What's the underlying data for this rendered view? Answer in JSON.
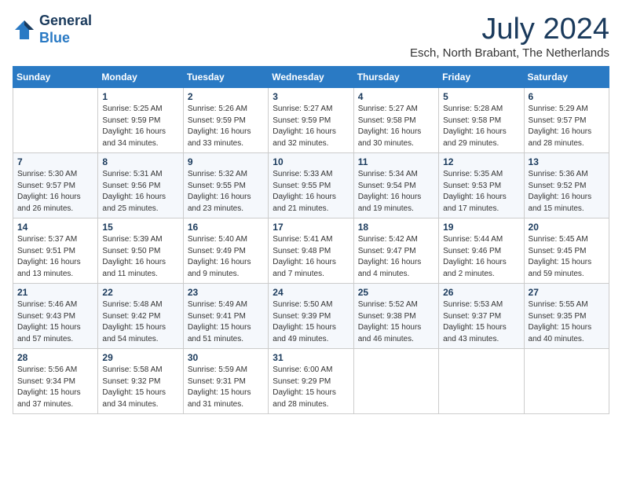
{
  "header": {
    "logo_line1": "General",
    "logo_line2": "Blue",
    "month_title": "July 2024",
    "location": "Esch, North Brabant, The Netherlands"
  },
  "columns": [
    "Sunday",
    "Monday",
    "Tuesday",
    "Wednesday",
    "Thursday",
    "Friday",
    "Saturday"
  ],
  "weeks": [
    [
      {
        "day": "",
        "info": ""
      },
      {
        "day": "1",
        "info": "Sunrise: 5:25 AM\nSunset: 9:59 PM\nDaylight: 16 hours\nand 34 minutes."
      },
      {
        "day": "2",
        "info": "Sunrise: 5:26 AM\nSunset: 9:59 PM\nDaylight: 16 hours\nand 33 minutes."
      },
      {
        "day": "3",
        "info": "Sunrise: 5:27 AM\nSunset: 9:59 PM\nDaylight: 16 hours\nand 32 minutes."
      },
      {
        "day": "4",
        "info": "Sunrise: 5:27 AM\nSunset: 9:58 PM\nDaylight: 16 hours\nand 30 minutes."
      },
      {
        "day": "5",
        "info": "Sunrise: 5:28 AM\nSunset: 9:58 PM\nDaylight: 16 hours\nand 29 minutes."
      },
      {
        "day": "6",
        "info": "Sunrise: 5:29 AM\nSunset: 9:57 PM\nDaylight: 16 hours\nand 28 minutes."
      }
    ],
    [
      {
        "day": "7",
        "info": "Sunrise: 5:30 AM\nSunset: 9:57 PM\nDaylight: 16 hours\nand 26 minutes."
      },
      {
        "day": "8",
        "info": "Sunrise: 5:31 AM\nSunset: 9:56 PM\nDaylight: 16 hours\nand 25 minutes."
      },
      {
        "day": "9",
        "info": "Sunrise: 5:32 AM\nSunset: 9:55 PM\nDaylight: 16 hours\nand 23 minutes."
      },
      {
        "day": "10",
        "info": "Sunrise: 5:33 AM\nSunset: 9:55 PM\nDaylight: 16 hours\nand 21 minutes."
      },
      {
        "day": "11",
        "info": "Sunrise: 5:34 AM\nSunset: 9:54 PM\nDaylight: 16 hours\nand 19 minutes."
      },
      {
        "day": "12",
        "info": "Sunrise: 5:35 AM\nSunset: 9:53 PM\nDaylight: 16 hours\nand 17 minutes."
      },
      {
        "day": "13",
        "info": "Sunrise: 5:36 AM\nSunset: 9:52 PM\nDaylight: 16 hours\nand 15 minutes."
      }
    ],
    [
      {
        "day": "14",
        "info": "Sunrise: 5:37 AM\nSunset: 9:51 PM\nDaylight: 16 hours\nand 13 minutes."
      },
      {
        "day": "15",
        "info": "Sunrise: 5:39 AM\nSunset: 9:50 PM\nDaylight: 16 hours\nand 11 minutes."
      },
      {
        "day": "16",
        "info": "Sunrise: 5:40 AM\nSunset: 9:49 PM\nDaylight: 16 hours\nand 9 minutes."
      },
      {
        "day": "17",
        "info": "Sunrise: 5:41 AM\nSunset: 9:48 PM\nDaylight: 16 hours\nand 7 minutes."
      },
      {
        "day": "18",
        "info": "Sunrise: 5:42 AM\nSunset: 9:47 PM\nDaylight: 16 hours\nand 4 minutes."
      },
      {
        "day": "19",
        "info": "Sunrise: 5:44 AM\nSunset: 9:46 PM\nDaylight: 16 hours\nand 2 minutes."
      },
      {
        "day": "20",
        "info": "Sunrise: 5:45 AM\nSunset: 9:45 PM\nDaylight: 15 hours\nand 59 minutes."
      }
    ],
    [
      {
        "day": "21",
        "info": "Sunrise: 5:46 AM\nSunset: 9:43 PM\nDaylight: 15 hours\nand 57 minutes."
      },
      {
        "day": "22",
        "info": "Sunrise: 5:48 AM\nSunset: 9:42 PM\nDaylight: 15 hours\nand 54 minutes."
      },
      {
        "day": "23",
        "info": "Sunrise: 5:49 AM\nSunset: 9:41 PM\nDaylight: 15 hours\nand 51 minutes."
      },
      {
        "day": "24",
        "info": "Sunrise: 5:50 AM\nSunset: 9:39 PM\nDaylight: 15 hours\nand 49 minutes."
      },
      {
        "day": "25",
        "info": "Sunrise: 5:52 AM\nSunset: 9:38 PM\nDaylight: 15 hours\nand 46 minutes."
      },
      {
        "day": "26",
        "info": "Sunrise: 5:53 AM\nSunset: 9:37 PM\nDaylight: 15 hours\nand 43 minutes."
      },
      {
        "day": "27",
        "info": "Sunrise: 5:55 AM\nSunset: 9:35 PM\nDaylight: 15 hours\nand 40 minutes."
      }
    ],
    [
      {
        "day": "28",
        "info": "Sunrise: 5:56 AM\nSunset: 9:34 PM\nDaylight: 15 hours\nand 37 minutes."
      },
      {
        "day": "29",
        "info": "Sunrise: 5:58 AM\nSunset: 9:32 PM\nDaylight: 15 hours\nand 34 minutes."
      },
      {
        "day": "30",
        "info": "Sunrise: 5:59 AM\nSunset: 9:31 PM\nDaylight: 15 hours\nand 31 minutes."
      },
      {
        "day": "31",
        "info": "Sunrise: 6:00 AM\nSunset: 9:29 PM\nDaylight: 15 hours\nand 28 minutes."
      },
      {
        "day": "",
        "info": ""
      },
      {
        "day": "",
        "info": ""
      },
      {
        "day": "",
        "info": ""
      }
    ]
  ]
}
